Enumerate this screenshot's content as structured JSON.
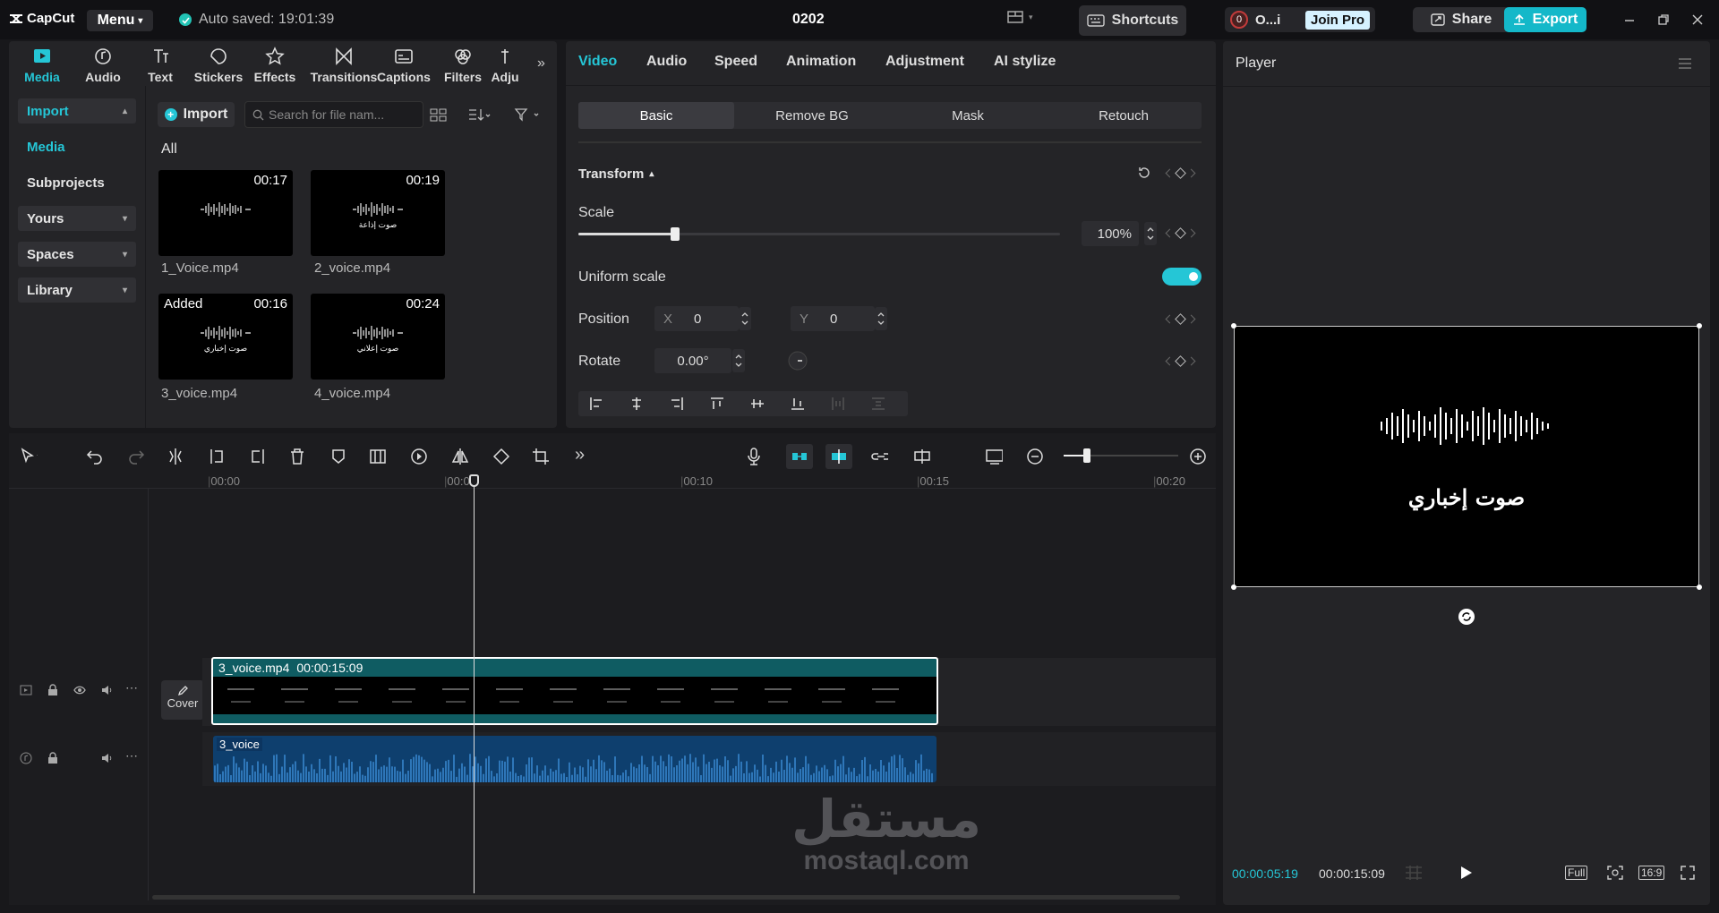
{
  "app": {
    "logo": "CapCut",
    "menu": "Menu",
    "autosave": "Auto saved: 19:01:39",
    "project": "0202",
    "shortcuts": "Shortcuts",
    "user_initial": "0",
    "user_name": "O...i",
    "join_pro": "Join Pro",
    "share": "Share",
    "export": "Export"
  },
  "media_tabs": [
    {
      "label": "Media",
      "icon": "media-icon"
    },
    {
      "label": "Audio",
      "icon": "audio-icon"
    },
    {
      "label": "Text",
      "icon": "text-icon"
    },
    {
      "label": "Stickers",
      "icon": "sticker-icon"
    },
    {
      "label": "Effects",
      "icon": "effects-icon"
    },
    {
      "label": "Transitions",
      "icon": "transitions-icon"
    },
    {
      "label": "Captions",
      "icon": "captions-icon"
    },
    {
      "label": "Filters",
      "icon": "filters-icon"
    },
    {
      "label": "Adju",
      "icon": "adjust-icon"
    }
  ],
  "sidebar": {
    "import": "Import",
    "media": "Media",
    "subprojects": "Subprojects",
    "yours": "Yours",
    "spaces": "Spaces",
    "library": "Library"
  },
  "media": {
    "import_button": "Import",
    "search_placeholder": "Search for file nam...",
    "filter_label": "All",
    "items": [
      {
        "name": "1_Voice.mp4",
        "duration": "00:17",
        "caption": ""
      },
      {
        "name": "2_voice.mp4",
        "duration": "00:19",
        "caption": "صوت إذاعة"
      },
      {
        "name": "3_voice.mp4",
        "duration": "00:16",
        "caption": "صوت إخباري",
        "added": "Added"
      },
      {
        "name": "4_voice.mp4",
        "duration": "00:24",
        "caption": "صوت إعلاني"
      }
    ]
  },
  "props": {
    "tabs": [
      "Video",
      "Audio",
      "Speed",
      "Animation",
      "Adjustment",
      "AI stylize"
    ],
    "subtabs": [
      "Basic",
      "Remove BG",
      "Mask",
      "Retouch"
    ],
    "transform": "Transform",
    "scale_label": "Scale",
    "scale_value": "100%",
    "scale_fraction": 0.2,
    "uniform_label": "Uniform scale",
    "position_label": "Position",
    "x_label": "X",
    "x_value": "0",
    "y_label": "Y",
    "y_value": "0",
    "rotate_label": "Rotate",
    "rotate_value": "0.00°"
  },
  "timeline": {
    "ruler": [
      "00:00",
      "00:05",
      "00:10",
      "00:15",
      "00:20"
    ],
    "cover": "Cover",
    "video_clip": {
      "name": "3_voice.mp4",
      "duration": "00:00:15:09"
    },
    "audio_clip": {
      "name": "3_voice"
    }
  },
  "player": {
    "title": "Player",
    "caption": "صوت إخباري",
    "current": "00:00:05:19",
    "total": "00:00:15:09",
    "full": "Full",
    "ratio": "16:9"
  },
  "watermark": {
    "arabic": "مستقل",
    "latin": "mostaql.com"
  }
}
